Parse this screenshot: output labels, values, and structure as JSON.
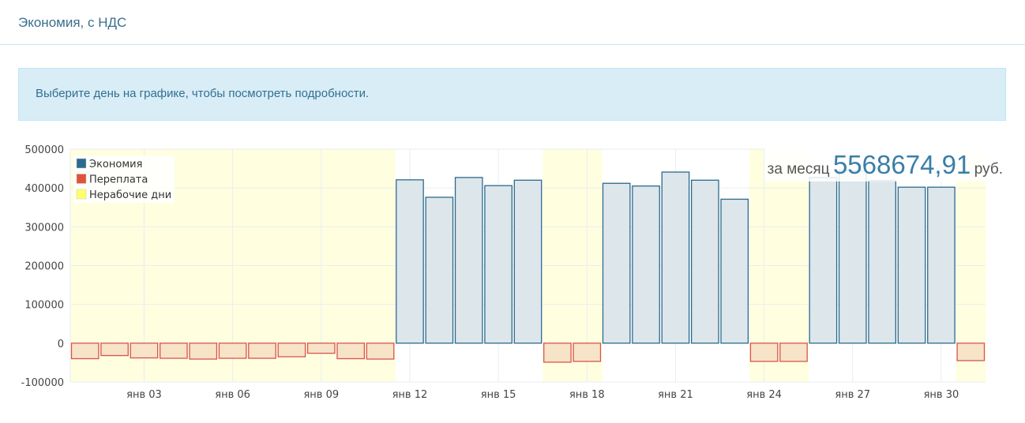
{
  "header": {
    "title": "Экономия, с НДС"
  },
  "alert": {
    "text": "Выберите день на графике, чтобы посмотреть подробности."
  },
  "total": {
    "prefix": "за месяц",
    "value": "5568674,91",
    "suffix": "руб."
  },
  "colors": {
    "economy_fill": "#dde6ea",
    "economy_stroke": "#2c6a8e",
    "overpay_fill": "#f7e3c8",
    "overpay_stroke": "#d9534f",
    "nonworking_fill": "#ffffe0",
    "grid": "#e8eef2"
  },
  "chart_data": {
    "type": "bar",
    "x_tick_labels": [
      "янв 03",
      "янв 06",
      "янв 09",
      "янв 12",
      "янв 15",
      "янв 18",
      "янв 21",
      "янв 24",
      "янв 27",
      "янв 30"
    ],
    "y_tick_labels": [
      "500000",
      "400000",
      "300000",
      "200000",
      "100000",
      "0",
      "-100000"
    ],
    "ylim": [
      -100000,
      500000
    ],
    "grid": true,
    "legend": {
      "placement": "top-left",
      "entries": [
        {
          "name": "Экономия",
          "color": "#2c6a8e"
        },
        {
          "name": "Переплата",
          "color": "#e0533a"
        },
        {
          "name": "Нерабочие дни",
          "color": "#ffff66"
        }
      ]
    },
    "days": [
      1,
      2,
      3,
      4,
      5,
      6,
      7,
      8,
      9,
      10,
      11,
      12,
      13,
      14,
      15,
      16,
      17,
      18,
      19,
      20,
      21,
      22,
      23,
      24,
      25,
      26,
      27,
      28,
      29,
      30,
      31
    ],
    "values": [
      -40000,
      -32000,
      -38000,
      -39000,
      -41000,
      -39000,
      -39000,
      -35000,
      -26000,
      -40000,
      -41000,
      421000,
      376000,
      427000,
      406000,
      420000,
      -49000,
      -47000,
      412000,
      405000,
      441000,
      420000,
      371000,
      -47000,
      -47000,
      427000,
      445000,
      419000,
      402000,
      402000,
      -45000
    ],
    "nonworking_days": [
      1,
      2,
      3,
      4,
      5,
      6,
      7,
      8,
      9,
      10,
      11,
      17,
      18,
      24,
      25,
      31
    ]
  }
}
